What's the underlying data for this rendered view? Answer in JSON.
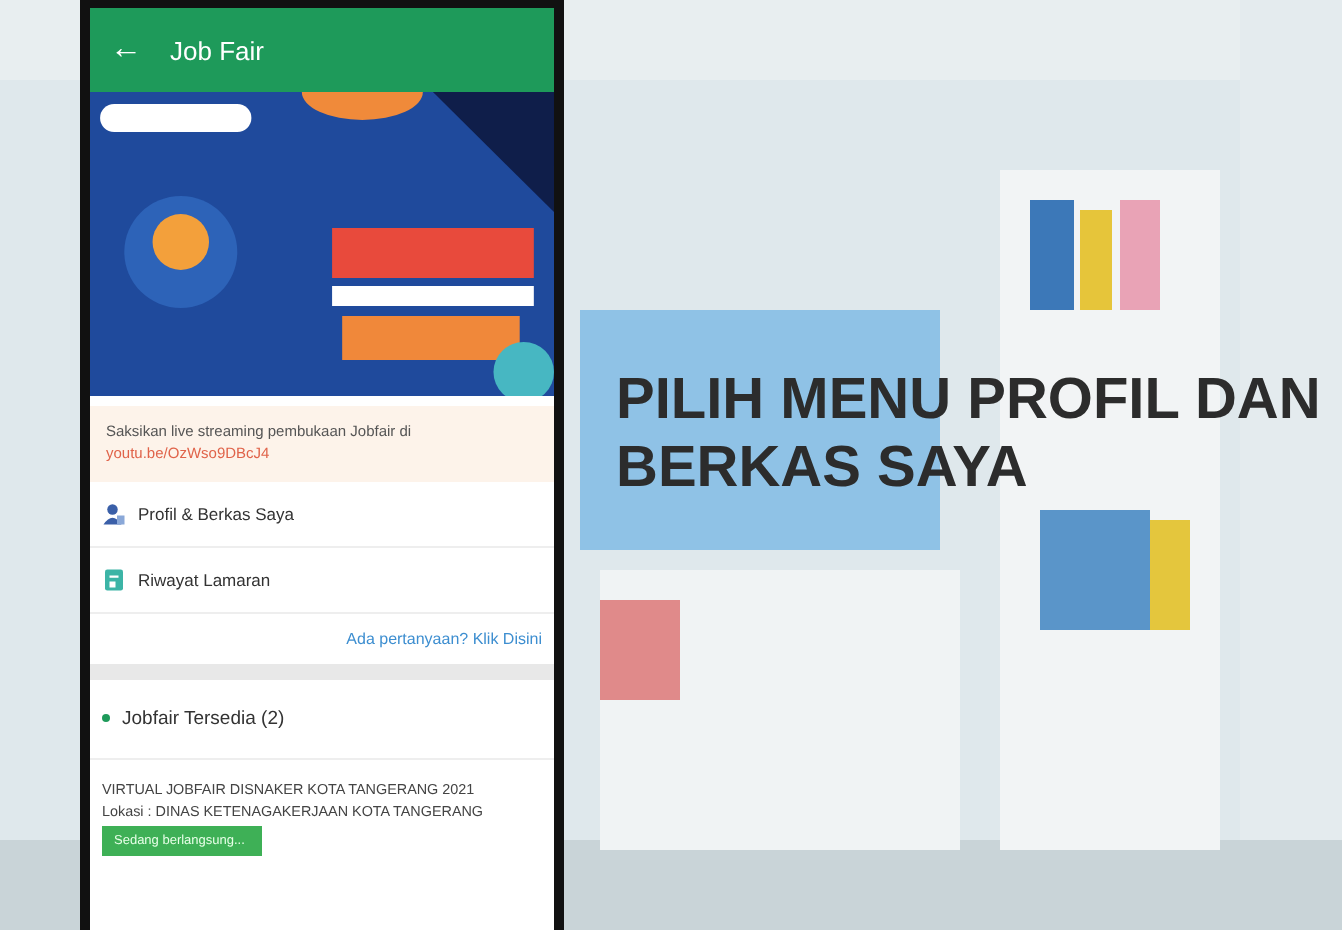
{
  "app_bar": {
    "back_icon": "←",
    "title": "Job Fair"
  },
  "notice": {
    "text": "Saksikan live streaming pembukaan Jobfair di ",
    "link": "youtu.be/OzWso9DBcJ4"
  },
  "menu": [
    {
      "kind": "profile",
      "label": "Profil & Berkas Saya"
    },
    {
      "kind": "history",
      "label": "Riwayat Lamaran"
    }
  ],
  "help_link": "Ada pertanyaan? Klik Disini",
  "section": {
    "title": "Jobfair Tersedia (2)"
  },
  "jobs": [
    {
      "title": "VIRTUAL JOBFAIR DISNAKER KOTA TANGERANG 2021",
      "location": "Lokasi : DINAS KETENAGAKERJAAN KOTA TANGERANG",
      "status": "Sedang berlangsung..."
    }
  ],
  "caption": [
    "PILIH MENU PROFIL DAN",
    "BERKAS SAYA"
  ]
}
